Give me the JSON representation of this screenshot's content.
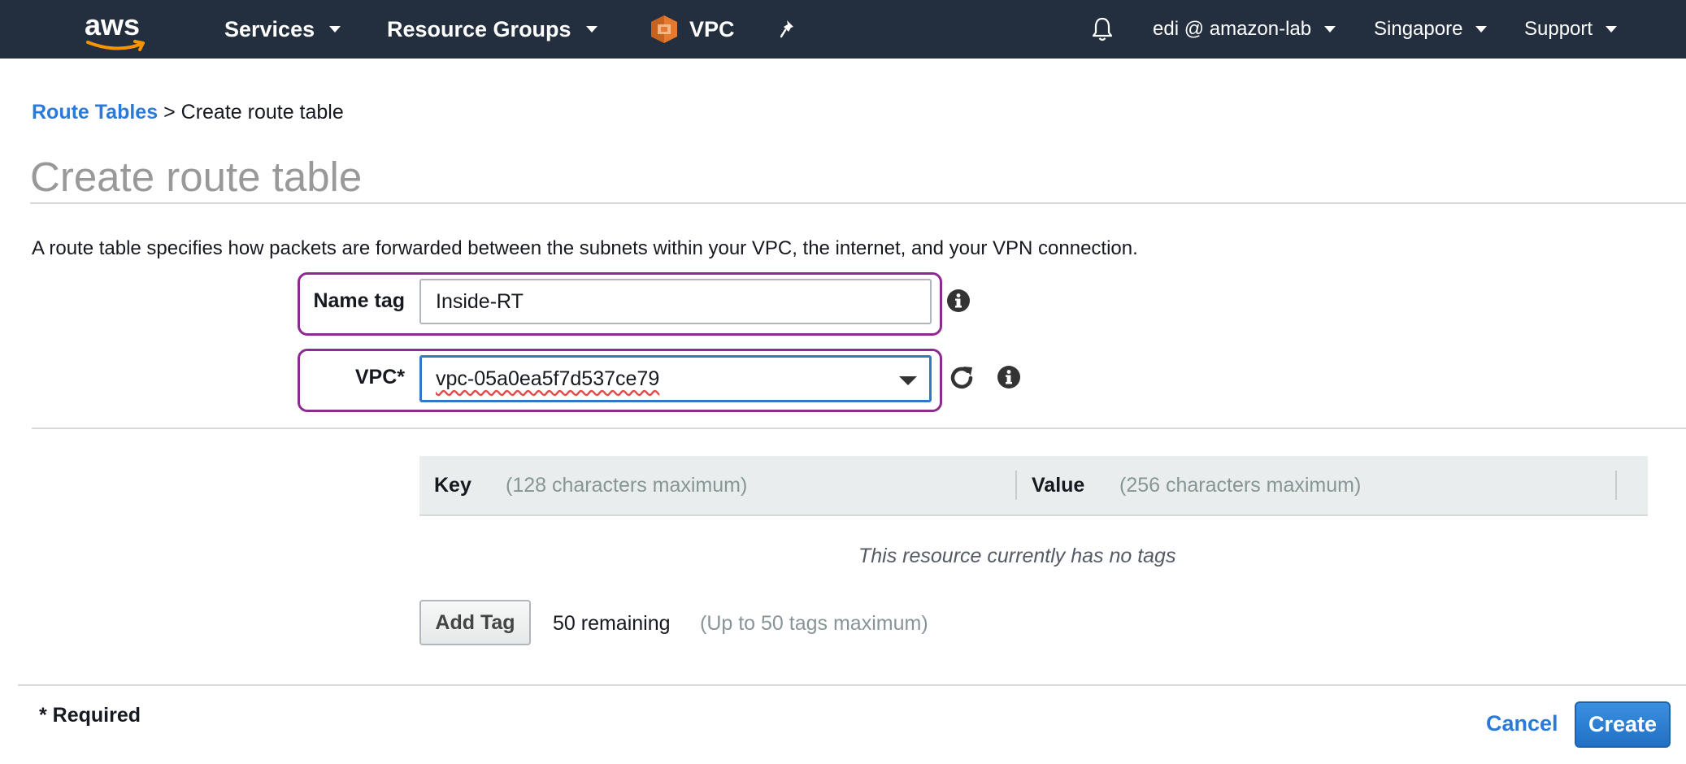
{
  "nav": {
    "logo_text": "aws",
    "services": "Services",
    "resource_groups": "Resource Groups",
    "vpc": "VPC",
    "user": "edi @ amazon-lab",
    "region": "Singapore",
    "support": "Support"
  },
  "breadcrumb": {
    "link": "Route Tables",
    "separator": ">",
    "current": "Create route table"
  },
  "page": {
    "title": "Create route table",
    "description": "A route table specifies how packets are forwarded between the subnets within your VPC, the internet, and your VPN connection."
  },
  "form": {
    "name_tag_label": "Name tag",
    "name_tag_value": "Inside-RT",
    "vpc_label": "VPC*",
    "vpc_value": "vpc-05a0ea5f7d537ce79"
  },
  "tags": {
    "key_header": "Key",
    "key_hint": "(128 characters maximum)",
    "value_header": "Value",
    "value_hint": "(256 characters maximum)",
    "empty_text": "This resource currently has no tags",
    "add_button": "Add Tag",
    "remaining": "50 remaining",
    "max_note": "(Up to 50 tags maximum)"
  },
  "footer": {
    "required": "* Required",
    "cancel": "Cancel",
    "create": "Create"
  },
  "colors": {
    "nav_bg": "#232f3e",
    "link": "#2a7ad9",
    "highlight": "#8c2b8f",
    "primary": "#2170c4",
    "vpc_icon": "#e57a2f"
  },
  "icons": [
    "bell-icon",
    "pin-icon",
    "vpc-icon",
    "refresh-icon",
    "info-icon",
    "caret-down-icon"
  ]
}
